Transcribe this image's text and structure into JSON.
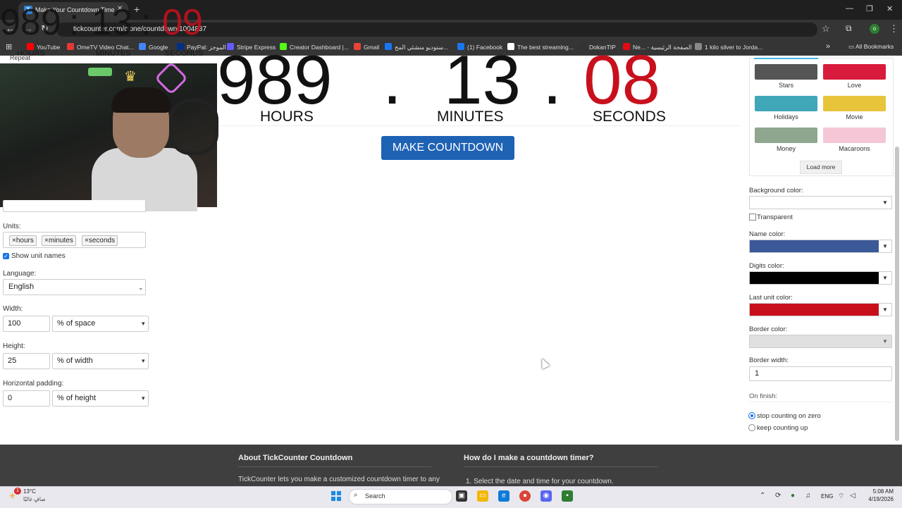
{
  "browser": {
    "tab_title": "Make Your Countdown Time",
    "tab_favicon": "T",
    "url": "tickcounter.com/clone/countdown/1004837",
    "profile_initial": "o",
    "bookmarks": [
      {
        "label": "YouTube",
        "color": "#ff0000"
      },
      {
        "label": "OmeTV Video Chat...",
        "color": "#e53935"
      },
      {
        "label": "Google",
        "color": "#4285f4"
      },
      {
        "label": "PayPal: الموجز",
        "color": "#003087"
      },
      {
        "label": "Stripe Express",
        "color": "#635bff"
      },
      {
        "label": "Creator Dashboard |...",
        "color": "#53fc18"
      },
      {
        "label": "Gmail",
        "color": "#ea4335"
      },
      {
        "label": "ستوديو منشئي المح...",
        "color": "#1877f2"
      },
      {
        "label": "(1) Facebook",
        "color": "#1877f2"
      },
      {
        "label": "The best streaming...",
        "color": "#ffffff"
      },
      {
        "label": "DokanTIP",
        "color": "#333333"
      },
      {
        "label": "Ne... - الصفحة الرئيسية",
        "color": "#e50914"
      },
      {
        "label": "1 kilo silver to Jorda...",
        "color": "#888888"
      }
    ],
    "all_bookmarks": "All Bookmarks"
  },
  "overlay": {
    "hours": "989",
    "sep1": ":",
    "minutes": "13",
    "sep2": ":",
    "seconds": "09",
    "unit_hours": "HOURS",
    "unit_minutes": "MINUTES",
    "unit_seconds": "SECONDS",
    "repeat_label": "Repeat"
  },
  "countdown": {
    "hours": "989",
    "minutes": "13",
    "seconds": "08",
    "sep": ".",
    "unit_hours": "HOURS",
    "unit_minutes": "MINUTES",
    "unit_seconds": "SECONDS",
    "last_unit_color": "#c8101d",
    "make_button": "MAKE COUNTDOWN"
  },
  "left_panel": {
    "units_label": "Units:",
    "unit_tags": [
      "×hours",
      "×minutes",
      "×seconds"
    ],
    "show_unit_names": "Show unit names",
    "language_label": "Language:",
    "language_value": "English",
    "width_label": "Width:",
    "width_value": "100",
    "width_unit": "% of space",
    "height_label": "Height:",
    "height_value": "25",
    "height_unit": "% of width",
    "padding_label": "Horizontal padding:",
    "padding_value": "0",
    "padding_unit": "% of height"
  },
  "right_panel": {
    "backgrounds": [
      {
        "label": "Stars",
        "color": "#555555"
      },
      {
        "label": "Love",
        "color": "#d81b3c"
      },
      {
        "label": "Holidays",
        "color": "#3fa7b8"
      },
      {
        "label": "Movie",
        "color": "#e8c43a"
      },
      {
        "label": "Money",
        "color": "#8fa68f"
      },
      {
        "label": "Macaroons",
        "color": "#f5c6d6"
      }
    ],
    "load_more": "Load more",
    "bg_color_label": "Background color:",
    "transparent_label": "Transparent",
    "name_color_label": "Name color:",
    "name_color": "#3b5998",
    "digits_color_label": "Digits color:",
    "digits_color": "#000000",
    "last_unit_color_label": "Last unit color:",
    "last_unit_color": "#c8101d",
    "border_color_label": "Border color:",
    "border_color": "#e0e0e0",
    "border_width_label": "Border width:",
    "border_width_value": "1",
    "on_finish_label": "On finish:",
    "finish_stop": "stop counting on zero",
    "finish_keep": "keep counting up"
  },
  "footer": {
    "col1_title": "About TickCounter Countdown",
    "col1_text": "TickCounter lets you make a customized countdown timer to any",
    "col2_title": "How do I make a countdown timer?",
    "col2_text": "1. Select the date and time for your countdown."
  },
  "taskbar": {
    "weather_temp": "13°C",
    "weather_desc": "صافٍ غالبًا",
    "weather_badge": "1",
    "search_placeholder": "Search",
    "lang": "ENG",
    "time": "5:08 AM",
    "date": "4/19/2026"
  }
}
